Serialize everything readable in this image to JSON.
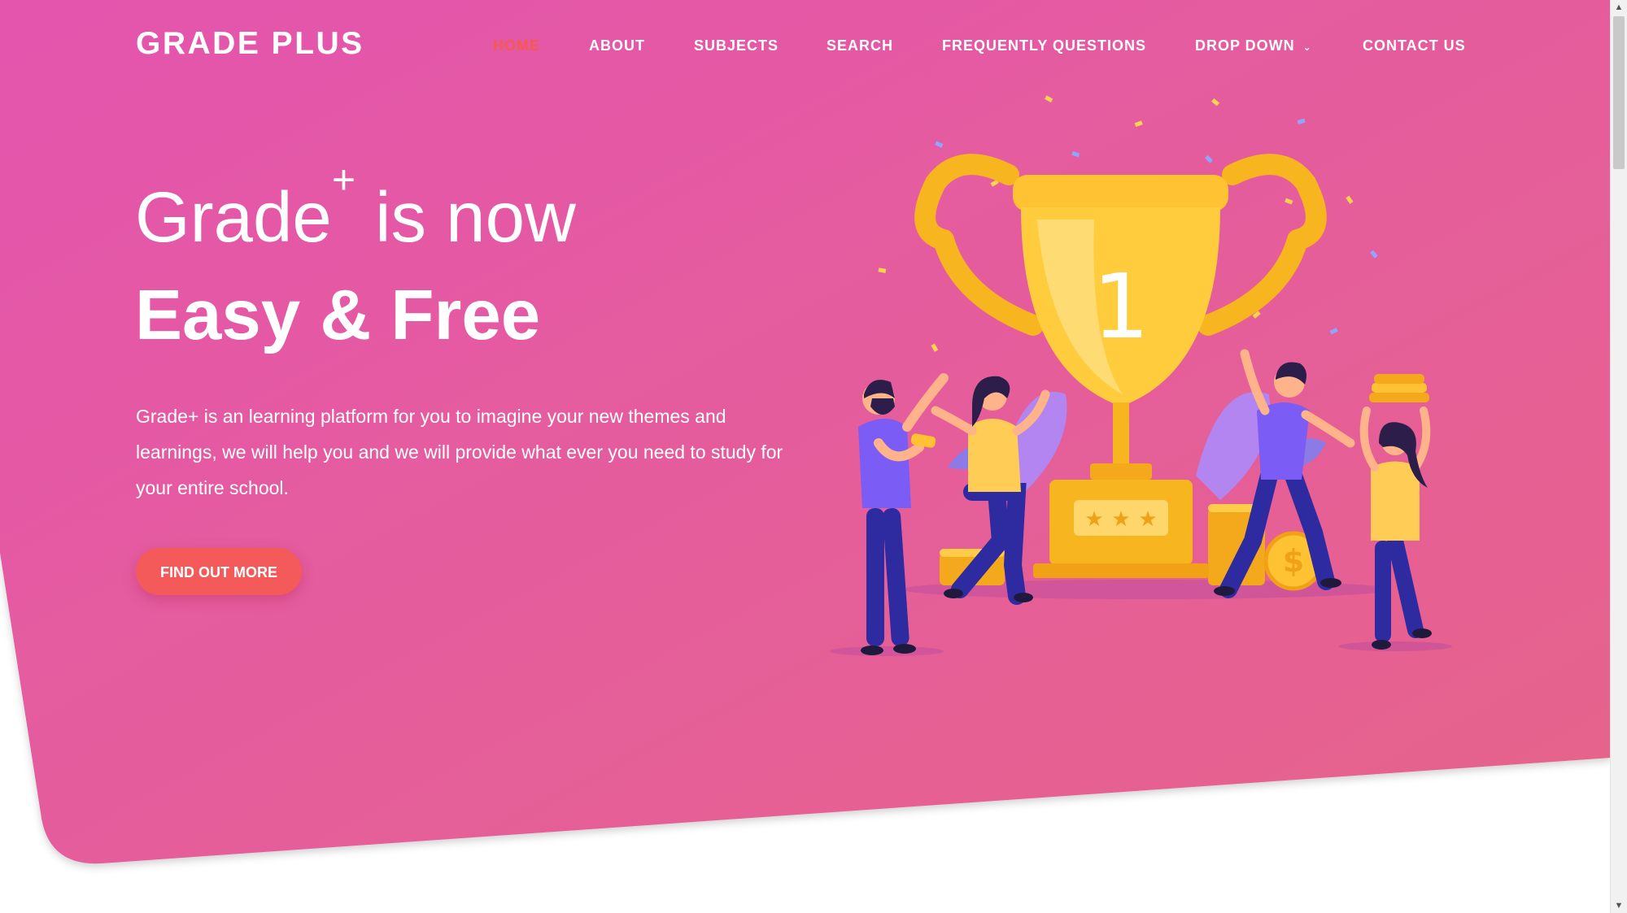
{
  "brand": {
    "name": "GRADE PLUS"
  },
  "nav": {
    "items": [
      {
        "label": "HOME",
        "active": true
      },
      {
        "label": "ABOUT"
      },
      {
        "label": "SUBJECTS"
      },
      {
        "label": "SEARCH"
      },
      {
        "label": "FREQUENTLY QUESTIONS"
      },
      {
        "label": "DROP DOWN",
        "icon": "chevron-down-icon"
      },
      {
        "label": "CONTACT US"
      }
    ]
  },
  "hero": {
    "title_word": "Grade",
    "title_sup": "+",
    "title_rest": " is now",
    "title_bold": "Easy & Free",
    "description": "Grade+ is an learning platform for you to imagine your new themes and learnings, we will help you and we will provide what ever you need to study for your entire school.",
    "cta_label": "FIND OUT MORE"
  },
  "illustration": {
    "trophy_number": "1"
  },
  "colors": {
    "hero_gradient_start": "#e455ae",
    "hero_gradient_end": "#e6648a",
    "accent": "#f55a4e",
    "trophy_gold": "#ffc233",
    "character_purple": "#7b5cf5",
    "character_navy": "#2e2aa0"
  }
}
